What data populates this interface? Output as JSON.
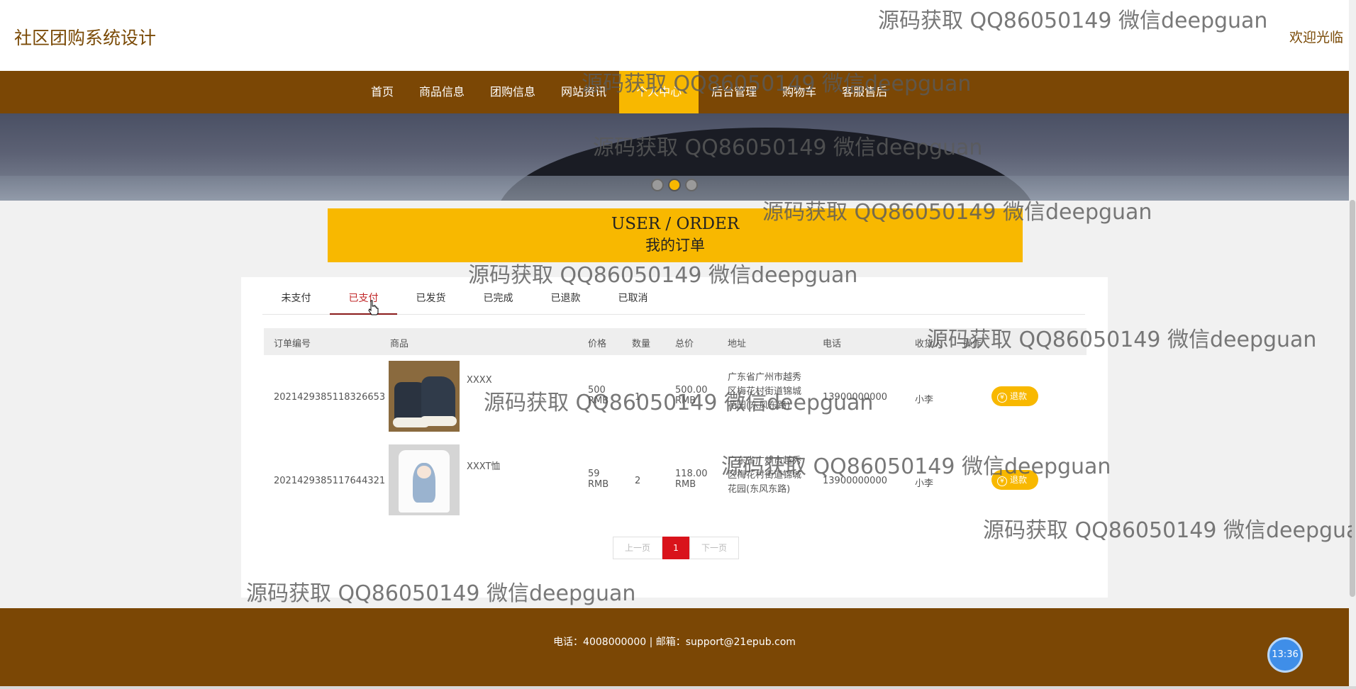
{
  "header": {
    "site_title": "社区团购系统设计",
    "welcome": "欢迎光临"
  },
  "nav": {
    "items": [
      {
        "label": "首页"
      },
      {
        "label": "商品信息"
      },
      {
        "label": "团购信息"
      },
      {
        "label": "网站资讯"
      },
      {
        "label": "个人中心",
        "active": true
      },
      {
        "label": "后台管理"
      },
      {
        "label": "购物车"
      },
      {
        "label": "客服售后"
      }
    ]
  },
  "banner": {
    "dots": 3,
    "active_dot": 2
  },
  "section": {
    "title_en": "USER / ORDER",
    "title_zh": "我的订单"
  },
  "tabs": [
    {
      "label": "未支付"
    },
    {
      "label": "已支付",
      "active": true
    },
    {
      "label": "已发货"
    },
    {
      "label": "已完成"
    },
    {
      "label": "已退款"
    },
    {
      "label": "已取消"
    }
  ],
  "table": {
    "headers": [
      "订单编号",
      "商品",
      "价格",
      "数量",
      "总价",
      "地址",
      "电话",
      "收货人",
      "操作"
    ],
    "rows": [
      {
        "order_no": "2021429385118326653",
        "product": "XXXX",
        "image": "sneaker-image",
        "price": "500 RMB",
        "qty": "1",
        "total": "500.00 RMB",
        "address": "广东省广州市越秀区梅花村街道锦城花园(东风东路)",
        "phone": "13900000000",
        "receiver": "小李",
        "action": "退款"
      },
      {
        "order_no": "2021429385117644321",
        "product": "XXXT恤",
        "image": "tshirt-image",
        "price": "59 RMB",
        "qty": "2",
        "total": "118.00 RMB",
        "address": "广东省广州市越秀区梅花村街道锦城花园(东风东路)",
        "phone": "13900000000",
        "receiver": "小李",
        "action": "退款"
      }
    ]
  },
  "pager": {
    "prev": "上一页",
    "current": "1",
    "next": "下一页"
  },
  "footer": {
    "text": "电话：4008000000 | 邮箱：support@21epub.com"
  },
  "clock": {
    "time": "13:36"
  },
  "watermark": {
    "text": "源码获取 QQ86050149 微信deepguan"
  },
  "colors": {
    "brand_brown": "#7b4705",
    "accent_yellow": "#f8b800",
    "active_red": "#d9131b"
  }
}
